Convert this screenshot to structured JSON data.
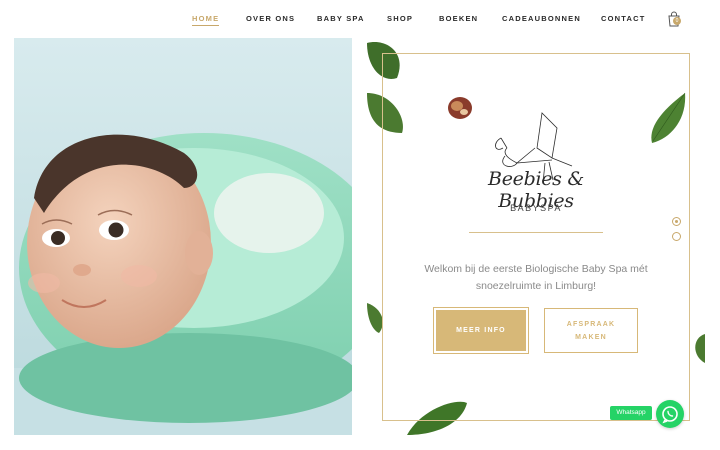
{
  "nav": {
    "items": [
      {
        "label": "HOME",
        "active": true
      },
      {
        "label": "OVER ONS",
        "active": false
      },
      {
        "label": "BABY SPA",
        "active": false
      },
      {
        "label": "SHOP",
        "active": false
      },
      {
        "label": "BOEKEN",
        "active": false
      },
      {
        "label": "CADEAUBONNEN",
        "active": false
      },
      {
        "label": "CONTACT",
        "active": false
      }
    ],
    "cart_count": "0",
    "cart_icon": "shopping-bag-icon"
  },
  "hero": {
    "logo_name": "Beebies & Bubbies",
    "logo_sub": "BABYSPA",
    "tagline": "Welkom bij de eerste Biologische Baby Spa mét snoezelruimte in Limburg!",
    "primary_button": "MEER INFO",
    "secondary_button": "AFSPRAAK MAKEN"
  },
  "slider": {
    "active_index": 0,
    "count": 2
  },
  "whatsapp": {
    "label": "Whatsapp",
    "icon": "whatsapp-icon"
  },
  "colors": {
    "accent": "#c8a86b",
    "button_gold": "#d7b878",
    "whatsapp_green": "#25d366"
  }
}
